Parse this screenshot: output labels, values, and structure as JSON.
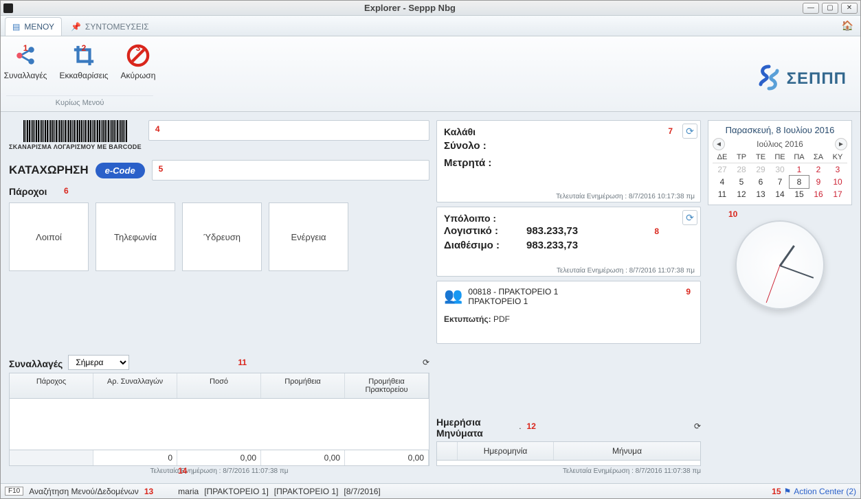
{
  "window": {
    "title": "Explorer - Seppp Nbg"
  },
  "tabs": {
    "menu": "ΜΕΝΟΥ",
    "shortcuts": "ΣΥΝΤΟΜΕΥΣΕΙΣ"
  },
  "ribbon": {
    "group_caption": "Κυρίως Μενού",
    "items": [
      {
        "label": "Συναλλαγές",
        "badge": "1"
      },
      {
        "label": "Εκκαθαρίσεις",
        "badge": "2"
      },
      {
        "label": "Ακύρωση",
        "badge": "3"
      }
    ]
  },
  "brand": "ΣΕΠΠΠ",
  "barcode_caption": "ΣΚΑΝΑΡΙΣΜΑ ΛΟΓΑΡΙΣΜΟΥ ΜΕ BARCODE",
  "field1_badge": "4",
  "field2": {
    "label": "ΚΑΤΑΧΩΡΗΣΗ",
    "pill": "e-Code",
    "badge": "5"
  },
  "providers": {
    "title": "Πάροχοι",
    "badge": "6",
    "items": [
      "Λοιποί",
      "Τηλεφωνία",
      "Ύδρευση",
      "Ενέργεια"
    ]
  },
  "basket": {
    "title": "Καλάθι",
    "badge": "7",
    "total_label": "Σύνολο :",
    "cash_label": "Μετρητά :",
    "updated": "Τελευταία Ενημέρωση : 8/7/2016   10:17:38 πμ"
  },
  "balance": {
    "title": "Υπόλοιπο :",
    "badge": "8",
    "rows": [
      {
        "label": "Λογιστικό :",
        "value": "983.233,73"
      },
      {
        "label": "Διαθέσιμο :",
        "value": "983.233,73"
      }
    ],
    "updated": "Τελευταία Ενημέρωση : 8/7/2016   11:07:38 πμ"
  },
  "agent": {
    "line1": "00818 - ΠΡΑΚΤΟΡΕΙΟ 1",
    "line2": "ΠΡΑΚΤΟΡΕΙΟ 1",
    "printer_label": "Εκτυπωτής:",
    "printer_value": "PDF",
    "badge": "9"
  },
  "calendar": {
    "date_title": "Παρασκευή, 8 Ιουλίου 2016",
    "month": "Ιούλιος 2016",
    "dow": [
      "ΔΕ",
      "ΤΡ",
      "ΤΕ",
      "ΠΕ",
      "ΠΑ",
      "ΣΑ",
      "ΚΥ"
    ],
    "badge": "10"
  },
  "transactions": {
    "title": "Συναλλαγές",
    "badge": "11",
    "filter": "Σήμερα",
    "columns": [
      "Πάροχος",
      "Αρ. Συναλλαγών",
      "Ποσό",
      "Προμήθεια",
      "Προμήθεια Πρακτορείου"
    ],
    "totals": [
      "",
      "0",
      "0,00",
      "0,00",
      "0,00"
    ],
    "updated": "Τελευταία Ενημέρωση : 8/7/2016   11:07:38 πμ",
    "updated_badge": "14"
  },
  "messages": {
    "title": "Ημερήσια Μηνύματα",
    "badge": "12",
    "dot": ".",
    "columns": [
      "Ημερομηνία",
      "Μήνυμα"
    ],
    "updated": "Τελευταία Ενημέρωση : 8/7/2016   11:07:38 πμ"
  },
  "status": {
    "f10": "F10",
    "search": "Αναζήτηση Μενού/Δεδομένων",
    "badge": "13",
    "user": "maria",
    "seg1": "[ΠΡΑΚΤΟΡΕΙΟ 1]",
    "seg2": "[ΠΡΑΚΤΟΡΕΙΟ 1]",
    "seg3": "[8/7/2016]",
    "action_center": "Action Center (2)",
    "ac_badge": "15"
  }
}
